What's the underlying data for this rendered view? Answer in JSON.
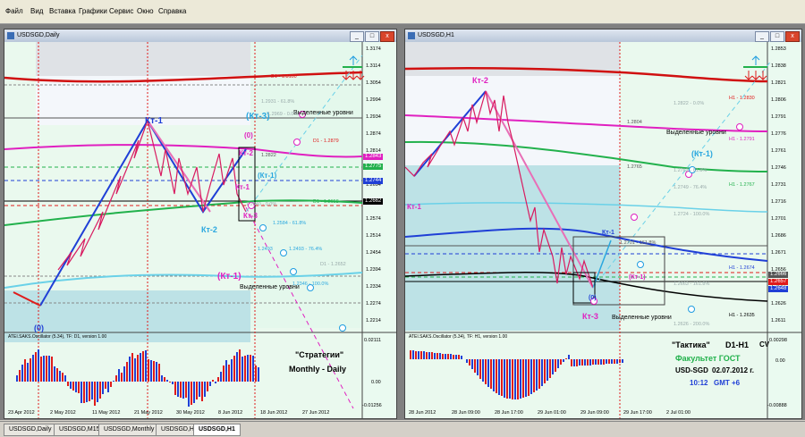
{
  "menu": {
    "items": [
      "Файл",
      "Вид",
      "Вставка",
      "Графики",
      "Сервис",
      "Окно",
      "Справка"
    ]
  },
  "colors": {
    "red": "#e01b1b",
    "blue": "#1f3fd6",
    "magenta": "#e020c0",
    "green": "#22b14c",
    "cyan_text": "#2aa7df"
  },
  "left": {
    "title": "USDSGD,Daily",
    "buttons": [
      "_",
      "□",
      "x"
    ],
    "labels": {
      "kt1": "Кт-1",
      "kt2a": "Кт-2",
      "kt2b": "Кт-2",
      "kt1b": "Кт-1",
      "kt3": "(Кт-3)",
      "kt3m": "Кт-3",
      "kt1_cyan": "(Кт-1)",
      "kt1_mag": "(Кт-1)",
      "zero1": "(0)",
      "zero2": "(0)",
      "levels1": "Выделенные уровни",
      "levels2": "Выделенные уровни",
      "t1": "1.2969 - 0.0%",
      "t2": "1.2931 - 61.8%",
      "t3": "1.2822",
      "t4": "1.2640 - 0.0%",
      "t5": "1.2584 - 61.8%",
      "t6": "1.2493",
      "t7": "1.2493 - 76.4%",
      "t8": "1.2346 - 100.0%",
      "t9": "D1 - 1.2652",
      "d1a": "D1 - 1.3100",
      "d1b": "D1 - 1.2879",
      "d1c": "D1 - 1.2658",
      "strat1": "\"Стратегии\"",
      "strat2": "Monthly - Daily",
      "osc": "ATEI.SAKS.Oscillator (5.34), TF: D1, version 1.00"
    },
    "price_scale": [
      "1.3174",
      "1.3114",
      "1.3054",
      "1.2994",
      "1.2934",
      "1.2874",
      "1.2814",
      "1.2754",
      "1.2694",
      "1.2634",
      "1.2574",
      "1.2514",
      "1.2454",
      "1.2394",
      "1.2334",
      "1.2274",
      "1.2214"
    ],
    "price_tags": [
      "1.2843",
      "1.2775",
      "1.2744",
      "1.2662"
    ],
    "osc_scale": [
      "0.02111",
      "0.00",
      "-0.01256"
    ],
    "dates": [
      "23 Apr 2012",
      "2 May 2012",
      "11 May 2012",
      "21 May 2012",
      "30 May 2012",
      "8 Jun 2012",
      "18 Jun 2012",
      "27 Jun 2012"
    ]
  },
  "right": {
    "title": "USDSGD,H1",
    "buttons": [
      "_",
      "□",
      "x"
    ],
    "labels": {
      "kt2": "Кт-2",
      "kt1a": "Кт-1",
      "kt1b": "Кт-1",
      "kt3": "Кт-3",
      "kt1_cyan": "(Кт-1)",
      "kt1_mag": "(Кт-1)",
      "zero": "(0)",
      "levels1": "Выделенные уровни",
      "levels2": "Выделенные уровни",
      "t1": "1.2822 - 0.0%",
      "t2": "1.2804",
      "t3": "1.2765",
      "t4": "1.2762 - 61.8%",
      "t5": "1.2749 - 76.4%",
      "t6": "1.2724 - 100.0%",
      "t7": "1.2701 - 161.8%",
      "t8": "1.2663 - 161.8%",
      "t9": "1.2626 - 200.0%",
      "h1a": "H1 - 1.2830",
      "h1b": "H1 - 1.2791",
      "h1c": "H1 - 1.2767",
      "h1d": "H1 - 1.2674",
      "h1e": "H1 - 1.2635",
      "tact1": "\"Тактика\"",
      "tact2": "D1-H1",
      "cv": "CV",
      "fac": "Факультет ГОСТ",
      "pair": "USD-SGD",
      "date": "02.07.2012 г.",
      "time": "10:12",
      "gmt": "GMT +6",
      "osc": "ATEI.SAKS.Oscillator (5.34), TF: H1, version 1.00"
    },
    "price_scale": [
      "1.2853",
      "1.2838",
      "1.2821",
      "1.2806",
      "1.2791",
      "1.2776",
      "1.2761",
      "1.2746",
      "1.2731",
      "1.2716",
      "1.2701",
      "1.2686",
      "1.2671",
      "1.2656",
      "1.2641",
      "1.2626",
      "1.2611"
    ],
    "price_tags": [
      "1.2666",
      "1.2657",
      "1.2648"
    ],
    "osc_scale": [
      "0.00298",
      "0.00",
      "-0.00888"
    ],
    "dates": [
      "28 Jun 2012",
      "28 Jun 09:00",
      "28 Jun 17:00",
      "29 Jun 01:00",
      "29 Jun 09:00",
      "29 Jun 17:00",
      "2 Jul 01:00"
    ]
  },
  "tabs": [
    "USDSGD,Daily",
    "USDSGD,M15",
    "USDSGD,Monthly",
    "USDSGD,H4",
    "USDSGD,H1"
  ]
}
